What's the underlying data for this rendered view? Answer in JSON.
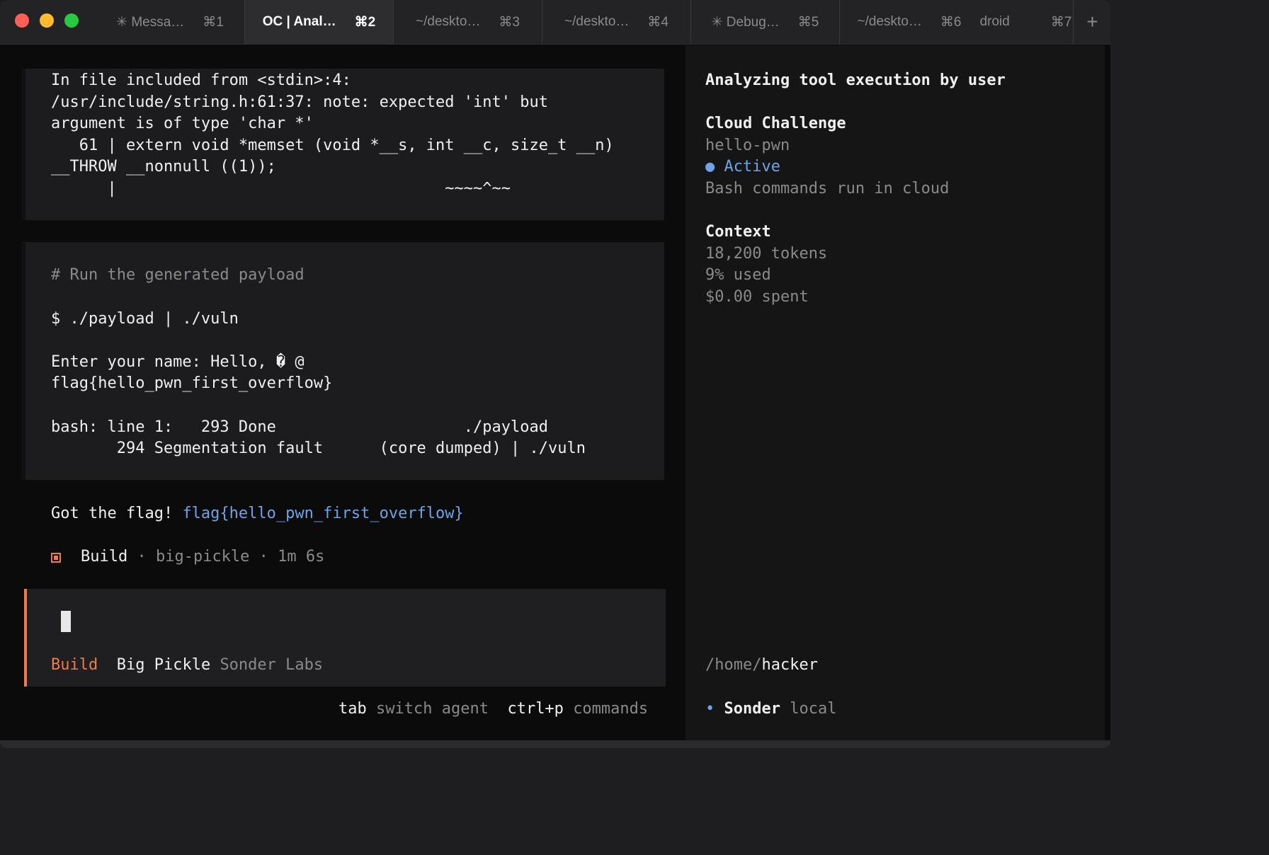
{
  "tabs": [
    {
      "label": "✳ Messa…",
      "shortcut": "⌘1"
    },
    {
      "label": "OC | Anal…",
      "shortcut": "⌘2"
    },
    {
      "label": "~/deskto…",
      "shortcut": "⌘3"
    },
    {
      "label": "~/deskto…",
      "shortcut": "⌘4"
    },
    {
      "label": "✳ Debug…",
      "shortcut": "⌘5"
    },
    {
      "label": "~/deskto…",
      "shortcut": "⌘6"
    },
    {
      "label": "droid",
      "shortcut": "⌘7"
    }
  ],
  "new_tab_label": "+",
  "output": {
    "compile_lines": [
      "In file included from <stdin>:4:",
      "/usr/include/string.h:61:37: note: expected 'int' but",
      "argument is of type 'char *'",
      "   61 | extern void *memset (void *__s, int __c, size_t __n)",
      "__THROW __nonnull ((1));",
      "      |                                   ~~~~^~~"
    ],
    "run_comment": "# Run the generated payload",
    "run_command": "$ ./payload | ./vuln",
    "run_out1": "Enter your name: Hello, � @",
    "run_out2": "flag{hello_pwn_first_overflow}",
    "bash_line1": "bash: line 1:   293 Done                    ./payload",
    "bash_line2": "       294 Segmentation fault      (core dumped) | ./vuln",
    "result_prefix": "Got the flag! ",
    "result_flag": "flag{hello_pwn_first_overflow}",
    "build_label": "Build",
    "build_meta": " · big-pickle · 1m 6s"
  },
  "input": {
    "agent": "Build",
    "model": "Big Pickle",
    "provider": "Sonder Labs"
  },
  "hints": {
    "tab_key": "tab",
    "tab_action": "switch agent",
    "cmd_key": "ctrl+p",
    "cmd_action": "commands"
  },
  "sidebar": {
    "title": "Analyzing tool execution by user",
    "cloud_heading": "Cloud Challenge",
    "challenge_name": "hello-pwn",
    "status": "Active",
    "status_note": "Bash commands run in cloud",
    "context_heading": "Context",
    "tokens": "18,200 tokens",
    "used": "9% used",
    "spent": "$0.00 spent",
    "path_prefix": "/home/",
    "path_user": "hacker",
    "host_name": "Sonder",
    "host_mode": "local"
  },
  "colors": {
    "accent": "#f07b4a",
    "link": "#6ea3e8",
    "status_active": "#6ea3e8"
  }
}
